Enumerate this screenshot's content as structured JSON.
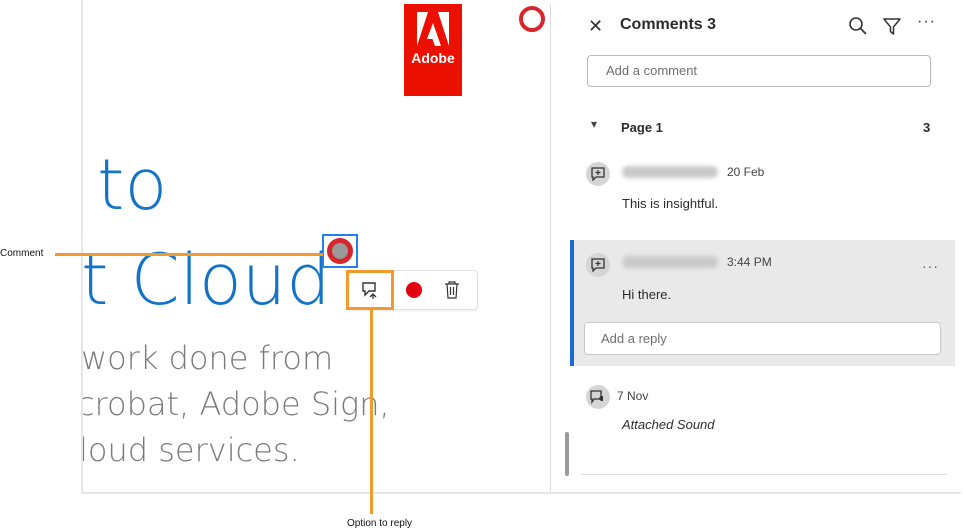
{
  "document": {
    "lines_large": [
      "to",
      "t Cloud"
    ],
    "lines_medium": [
      "work done from",
      "crobat, Adobe Sign,",
      "loud services."
    ],
    "logo_text": "Adobe"
  },
  "mini_toolbar": {
    "reply_icon": "reply-icon",
    "record_icon": "record-icon",
    "delete_icon": "trash-icon"
  },
  "callouts": {
    "comment_label": "Comment",
    "reply_label": "Option to reply"
  },
  "panel": {
    "close_icon": "close-icon",
    "title": "Comments 3",
    "search_icon": "search-icon",
    "filter_icon": "filter-icon",
    "more_icon": "more-icon",
    "add_comment_placeholder": "Add a comment",
    "page_group": {
      "label": "Page 1",
      "count": "3"
    },
    "comments": [
      {
        "date": "20 Feb",
        "text": "This is insightful."
      },
      {
        "date": "3:44 PM",
        "text": "Hi there.",
        "reply_placeholder": "Add a reply"
      },
      {
        "date": "7 Nov",
        "text": "Attached Sound"
      }
    ]
  },
  "colors": {
    "accent_blue": "#1473c4",
    "adobe_red": "#eb1000",
    "callout_orange": "#f29a2e",
    "selection_blue": "#1c6ad8"
  }
}
